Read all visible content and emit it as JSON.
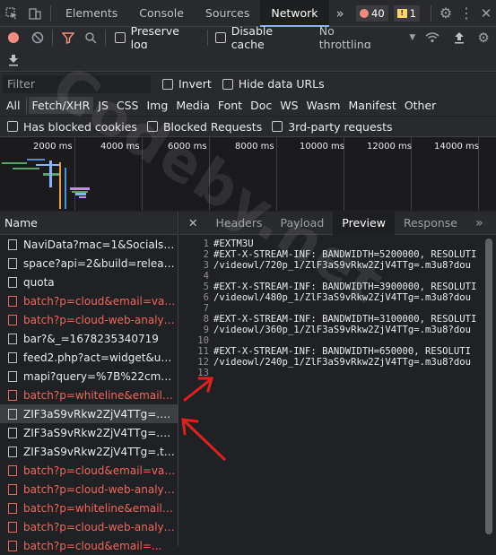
{
  "topbar": {
    "tabs": [
      "Elements",
      "Console",
      "Sources",
      "Network"
    ],
    "active_tab": "Network",
    "more": "»",
    "errors": "40",
    "warnings": "1"
  },
  "toolbar": {
    "preserve_log": "Preserve log",
    "disable_cache": "Disable cache",
    "throttling": "No throttling"
  },
  "filter": {
    "placeholder": "Filter",
    "invert": "Invert",
    "hide_data_urls": "Hide data URLs"
  },
  "types": [
    "All",
    "Fetch/XHR",
    "JS",
    "CSS",
    "Img",
    "Media",
    "Font",
    "Doc",
    "WS",
    "Wasm",
    "Manifest",
    "Other"
  ],
  "active_type": "Fetch/XHR",
  "blocked": {
    "blocked_cookies": "Has blocked cookies",
    "blocked_requests": "Blocked Requests",
    "third_party": "3rd-party requests"
  },
  "timeline": {
    "ticks": [
      "2000 ms",
      "4000 ms",
      "6000 ms",
      "8000 ms",
      "10000 ms",
      "12000 ms",
      "14000 ms"
    ]
  },
  "requests": {
    "header": "Name",
    "items": [
      {
        "name": "NaviData?mac=1&Socials=1...",
        "status": "ok"
      },
      {
        "name": "space?api=2&build=release-c...",
        "status": "ok"
      },
      {
        "name": "quota",
        "status": "ok"
      },
      {
        "name": "batch?p=cloud&email=vagne...",
        "status": "error"
      },
      {
        "name": "batch?p=cloud-web-analytics...",
        "status": "error"
      },
      {
        "name": "bar?&_=1678235340719",
        "status": "ok"
      },
      {
        "name": "feed2.php?act=widget&utm_...",
        "status": "ok"
      },
      {
        "name": "mapi?query=%7B%22cmd%2...",
        "status": "ok"
      },
      {
        "name": "batch?p=whiteline&email=va...",
        "status": "error"
      },
      {
        "name": "ZIF3aS9vRkw2ZjV4TTg=.m3u8...",
        "status": "selected"
      },
      {
        "name": "ZIF3aS9vRkw2ZjV4TTg=.m3u8...",
        "status": "ok"
      },
      {
        "name": "ZIF3aS9vRkw2ZjV4TTg=.ts?do...",
        "status": "ok"
      },
      {
        "name": "batch?p=cloud&email=vagne...",
        "status": "error"
      },
      {
        "name": "batch?p=cloud-web-analytics...",
        "status": "error"
      },
      {
        "name": "batch?p=whiteline&email=va...",
        "status": "error"
      },
      {
        "name": "batch?p=cloud-web-analytics...",
        "status": "error"
      },
      {
        "name": "batch?p=cloud&email=...",
        "status": "error"
      }
    ]
  },
  "detail": {
    "tabs": [
      "Headers",
      "Payload",
      "Preview",
      "Response"
    ],
    "active_tab": "Preview",
    "more": "»",
    "lines": [
      {
        "n": "1",
        "text": "#EXTM3U"
      },
      {
        "n": "2",
        "text": "#EXT-X-STREAM-INF: BANDWIDTH=5200000, RESOLUTI"
      },
      {
        "n": "3",
        "text": "/videowl/720p_1/ZlF3aS9vRkw2ZjV4TTg=.m3u8?dou"
      },
      {
        "n": "4",
        "text": ""
      },
      {
        "n": "5",
        "text": "#EXT-X-STREAM-INF: BANDWIDTH=3900000, RESOLUTI"
      },
      {
        "n": "6",
        "text": "/videowl/480p_1/ZlF3aS9vRkw2ZjV4TTg=.m3u8?dou"
      },
      {
        "n": "7",
        "text": ""
      },
      {
        "n": "8",
        "text": "#EXT-X-STREAM-INF: BANDWIDTH=3100000, RESOLUTI"
      },
      {
        "n": "9",
        "text": "/videowl/360p_1/ZlF3aS9vRkw2ZjV4TTg=.m3u8?dou"
      },
      {
        "n": "10",
        "text": ""
      },
      {
        "n": "11",
        "text": "#EXT-X-STREAM-INF: BANDWIDTH=650000, RESOLUTI"
      },
      {
        "n": "12",
        "text": "/videowl/240p_1/ZlF3aS9vRkw2ZjV4TTg=.m3u8?dou"
      },
      {
        "n": "13",
        "text": ""
      }
    ]
  },
  "watermark": "Codeby.net",
  "colors": {
    "accent": "#8ab4f8",
    "error": "#ee675c",
    "record": "#f28b82",
    "arrow": "#e0201f"
  }
}
